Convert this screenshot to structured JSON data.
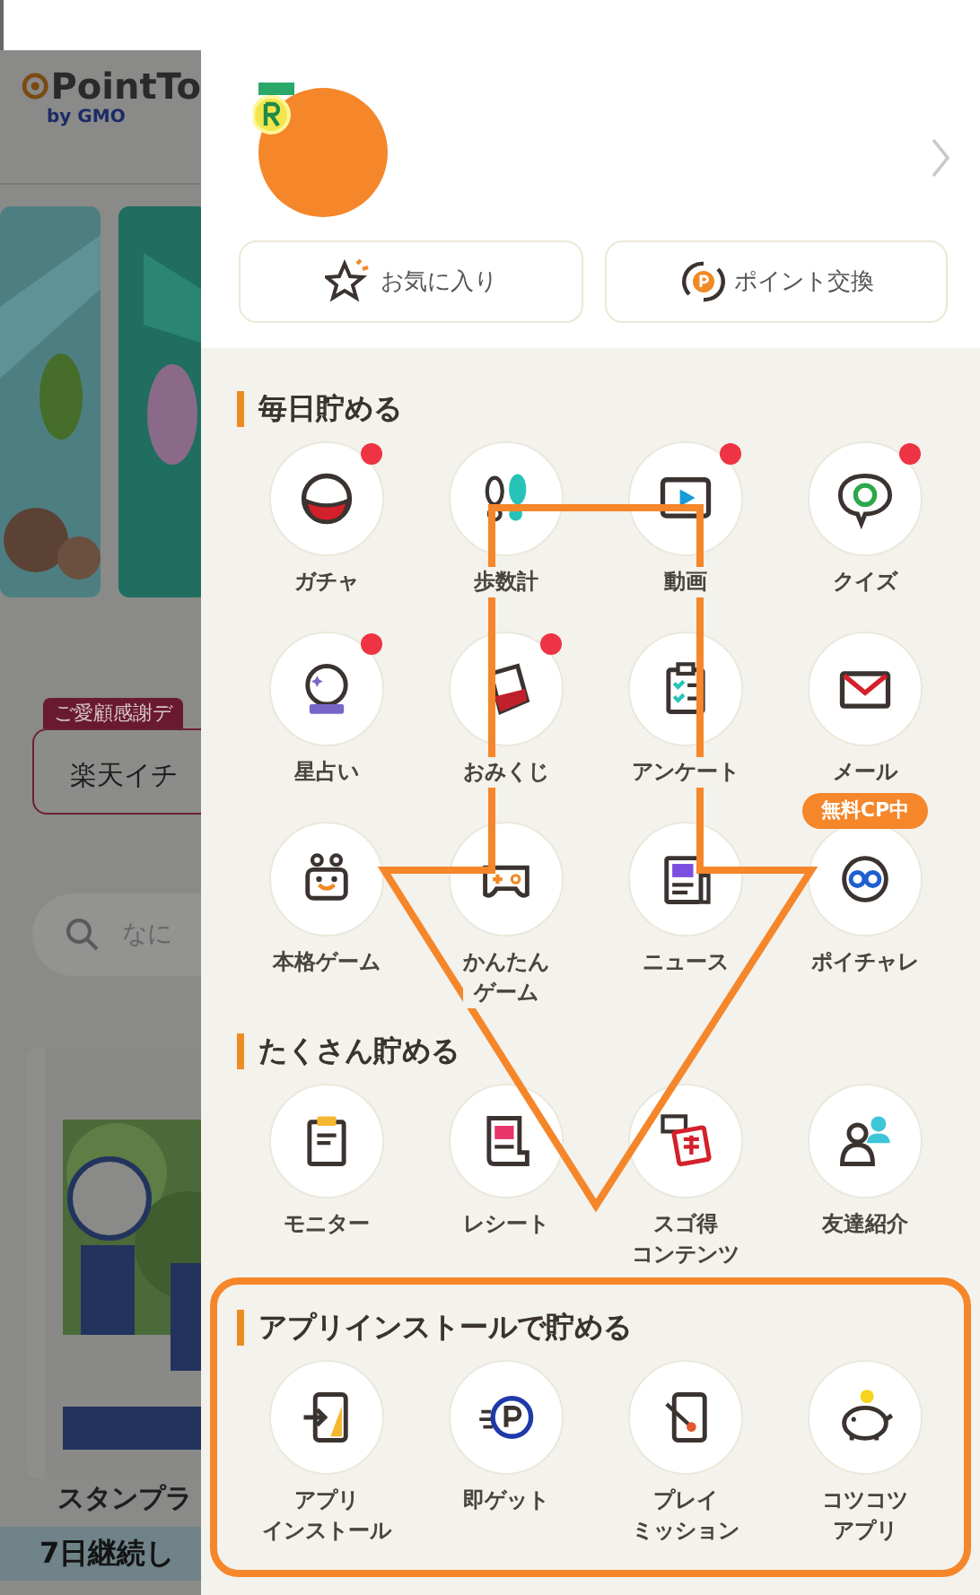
{
  "background_page": {
    "logo": "PointTo",
    "logo_sub": "by GMO",
    "campaign_tag": "ご愛顧感謝デ",
    "campaign_text": "楽天イチ",
    "search_placeholder": "なに",
    "card_caption": "スタンプラ",
    "banner_text": "7日継続し"
  },
  "buttons": [
    {
      "label": "お気に入り"
    },
    {
      "label": "ポイント交換"
    }
  ],
  "sections": [
    {
      "title": "毎日貯める",
      "items": [
        {
          "lines": [
            "ガチャ"
          ],
          "badge": true
        },
        {
          "lines": [
            "歩数計"
          ],
          "badge": false
        },
        {
          "lines": [
            "動画"
          ],
          "badge": true
        },
        {
          "lines": [
            "クイズ"
          ],
          "badge": true
        },
        {
          "lines": [
            "星占い"
          ],
          "badge": true
        },
        {
          "lines": [
            "おみくじ"
          ],
          "badge": true
        },
        {
          "lines": [
            "アンケート"
          ],
          "badge": false
        },
        {
          "lines": [
            "メール"
          ],
          "badge": false
        },
        {
          "lines": [
            "本格ゲーム"
          ],
          "badge": false
        },
        {
          "lines": [
            "かんたん",
            "ゲーム"
          ],
          "badge": false
        },
        {
          "lines": [
            "ニュース"
          ],
          "badge": false
        },
        {
          "lines": [
            "ポイチャレ"
          ],
          "badge": false,
          "tag": "無料CP中"
        }
      ]
    },
    {
      "title": "たくさん貯める",
      "items": [
        {
          "lines": [
            "モニター"
          ],
          "badge": false
        },
        {
          "lines": [
            "レシート"
          ],
          "badge": false
        },
        {
          "lines": [
            "スゴ得",
            "コンテンツ"
          ],
          "badge": false
        },
        {
          "lines": [
            "友達紹介"
          ],
          "badge": false
        }
      ]
    },
    {
      "title": "アプリインストールで貯める",
      "items": [
        {
          "lines": [
            "アプリ",
            "インストール"
          ],
          "badge": false
        },
        {
          "lines": [
            "即ゲット"
          ],
          "badge": false
        },
        {
          "lines": [
            "プレイ",
            "ミッション"
          ],
          "badge": false
        },
        {
          "lines": [
            "コツコツ",
            "アプリ"
          ],
          "badge": false
        }
      ]
    }
  ]
}
